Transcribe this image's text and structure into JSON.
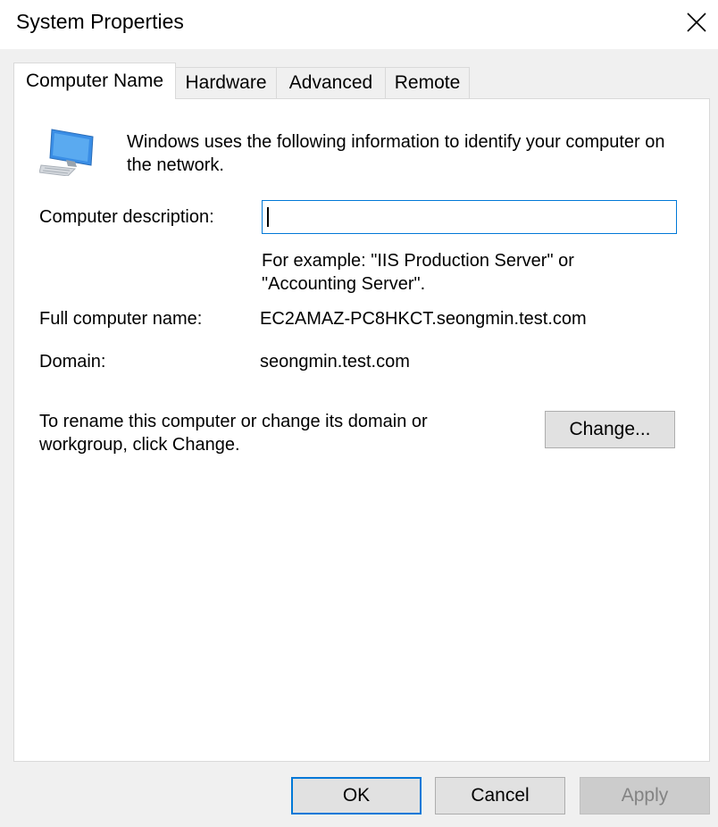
{
  "window": {
    "title": "System Properties"
  },
  "tabs": [
    {
      "label": "Computer Name",
      "active": true
    },
    {
      "label": "Hardware",
      "active": false
    },
    {
      "label": "Advanced",
      "active": false
    },
    {
      "label": "Remote",
      "active": false
    }
  ],
  "panel": {
    "intro": "Windows uses the following information to identify your computer on the network.",
    "description_label": "Computer description:",
    "description_value": "",
    "example": "For example: \"IIS Production Server\" or \"Accounting Server\".",
    "full_name_label": "Full computer name:",
    "full_name_value": "EC2AMAZ-PC8HKCT.seongmin.test.com",
    "domain_label": "Domain:",
    "domain_value": "seongmin.test.com",
    "rename_text": "To rename this computer or change its domain or workgroup, click Change.",
    "change_label": "Change..."
  },
  "footer": {
    "ok_label": "OK",
    "cancel_label": "Cancel",
    "apply_label": "Apply"
  },
  "icons": {
    "close": "close-icon",
    "computer": "computer-icon"
  },
  "colors": {
    "accent": "#0078d7",
    "window_bg": "#f0f0f0",
    "panel_bg": "#ffffff"
  }
}
